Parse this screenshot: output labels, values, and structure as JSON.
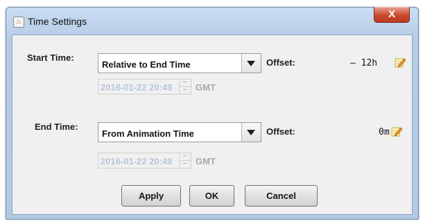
{
  "window": {
    "title": "Time Settings",
    "close_label": "X"
  },
  "start": {
    "label": "Start Time:",
    "mode": "Relative to End Time",
    "offset_label": "Offset:",
    "offset_value": "– 12h",
    "date": "2016-01-22 20:49",
    "timezone": "GMT"
  },
  "end": {
    "label": "End Time:",
    "mode": "From Animation Time",
    "offset_label": "Offset:",
    "offset_value": "0m",
    "date": "2016-01-22 20:49",
    "timezone": "GMT"
  },
  "buttons": {
    "apply": "Apply",
    "ok": "OK",
    "cancel": "Cancel"
  },
  "icons": {
    "app": "java-app-icon",
    "edit": "pencil-edit-icon",
    "dropdown": "triangle-down-icon",
    "close": "close-icon"
  },
  "colors": {
    "close_button": "#c9492f",
    "disabled_text": "#b8c6d8",
    "window_frame": "#b6cce6"
  }
}
